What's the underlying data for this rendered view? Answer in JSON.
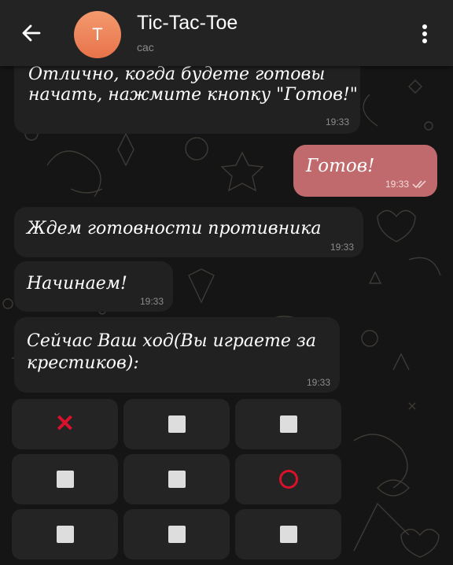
{
  "header": {
    "back_icon": "arrow-left-icon",
    "avatar_letter": "T",
    "avatar_color": "#ee8257",
    "title": "Tic-Tac-Toe",
    "subtitle": "сас",
    "menu_icon": "more-vertical-icon"
  },
  "messages": [
    {
      "text_lines": [
        "Отлично, когда будете готовы",
        "начать, нажмите кнопку \"Готов!\""
      ],
      "time": "19:33",
      "direction": "incoming"
    },
    {
      "text_lines": [
        "Готов!"
      ],
      "time": "19:33",
      "direction": "outgoing",
      "status_icon": "double-check-icon"
    },
    {
      "text_lines": [
        "Ждем готовности противника"
      ],
      "time": "19:33",
      "direction": "incoming"
    },
    {
      "text_lines": [
        "Начинаем!"
      ],
      "time": "19:33",
      "direction": "incoming"
    },
    {
      "text_lines": [
        "Сейчас Ваш ход(Вы играете за",
        "крестиков):"
      ],
      "time": "19:33",
      "direction": "incoming"
    }
  ],
  "board": {
    "rows": [
      [
        {
          "mark": "✕"
        },
        {
          "mark": "■"
        },
        {
          "mark": "■"
        }
      ],
      [
        {
          "mark": "■"
        },
        {
          "mark": "■"
        },
        {
          "mark": "○"
        }
      ],
      [
        {
          "mark": "■"
        },
        {
          "mark": "■"
        },
        {
          "mark": "■"
        }
      ]
    ]
  },
  "colors": {
    "background": "#151515",
    "header": "#232323",
    "incoming_bubble": "#212121",
    "outgoing_bubble": "#c16a6e",
    "mark_red": "#e8112d"
  }
}
